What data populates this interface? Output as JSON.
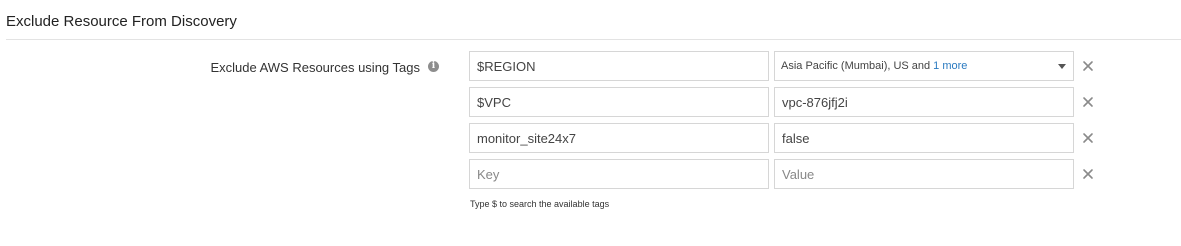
{
  "section": {
    "title": "Exclude Resource From Discovery"
  },
  "field": {
    "label": "Exclude AWS Resources using Tags",
    "info_icon": "info-icon",
    "info_glyph": "i"
  },
  "tag_rows": [
    {
      "key": "$REGION",
      "value_type": "select",
      "value_selected": "Asia Pacific (Mumbai), US and",
      "value_more_link": "1 more"
    },
    {
      "key": "$VPC",
      "value_type": "text",
      "value": "vpc-876jfj2i"
    },
    {
      "key": "monitor_site24x7",
      "value_type": "text",
      "value": "false"
    },
    {
      "key": "",
      "key_placeholder": "Key",
      "value_type": "text",
      "value": "",
      "value_placeholder": "Value"
    }
  ],
  "hint": "Type $ to search the available tags",
  "icons": {
    "remove": "close-icon",
    "dropdown": "chevron-down-icon"
  },
  "colors": {
    "link": "#2a7ac0",
    "border": "#d6d6d6",
    "remove_icon": "#8a8a8a"
  }
}
